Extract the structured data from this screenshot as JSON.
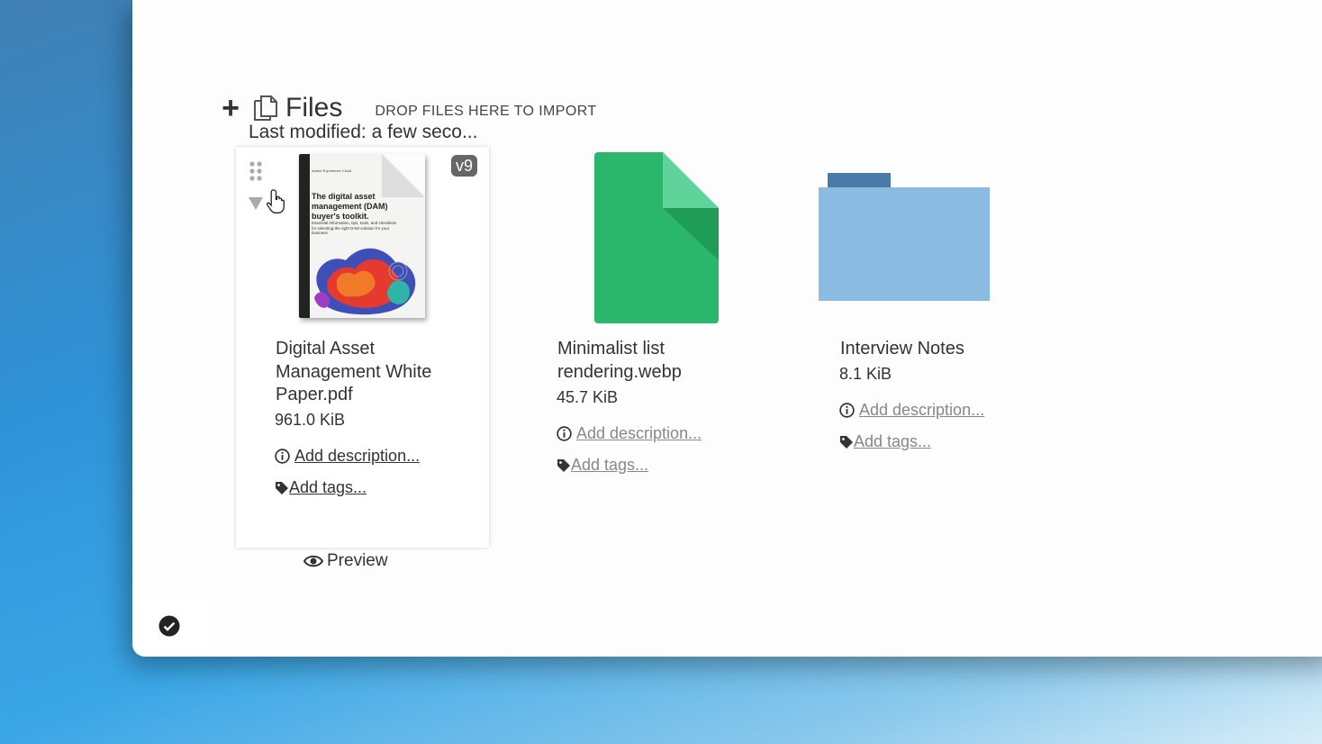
{
  "header": {
    "add_icon": "plus-icon",
    "files_icon": "files-copy-icon",
    "title": "Files",
    "drop_hint": "DROP FILES HERE TO IMPORT",
    "last_modified": "Last modified: a few seco..."
  },
  "cards": [
    {
      "name": "Digital Asset Management White Paper.pdf",
      "size": "961.0 KiB",
      "version": "v9",
      "description_link": "Add description...",
      "tags_link": "Add tags...",
      "thumbnail": {
        "brand": "Adobe Experience Cloud",
        "title": "The digital asset management (DAM) buyer's toolkit.",
        "subtitle": "Essential information, tips, tools, and checklists for selecting the right DAM solution for your business."
      },
      "selected": true
    },
    {
      "name": "Minimalist list rendering.webp",
      "size": "45.7 KiB",
      "description_link": "Add description...",
      "tags_link": "Add tags...",
      "icon": "green-file-icon",
      "selected": false
    },
    {
      "name": "Interview Notes",
      "size": "8.1 KiB",
      "description_link": "Add description...",
      "tags_link": "Add tags...",
      "icon": "folder-icon",
      "selected": false
    }
  ],
  "preview_label": "Preview",
  "colors": {
    "green_file": "#2bb76b",
    "green_fold": "#1f9d57",
    "folder_body": "#8bbbe0",
    "folder_tab": "#4a7aa8",
    "badge": "#666666"
  }
}
